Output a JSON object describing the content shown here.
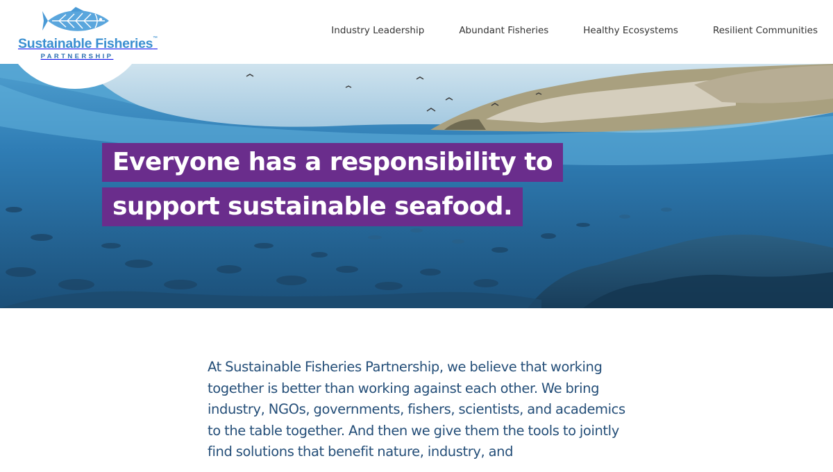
{
  "brand": {
    "name": "Sustainable Fisheries",
    "tm": "™",
    "subtitle": "PARTNERSHIP"
  },
  "nav": {
    "items": [
      {
        "label": "Industry Leadership"
      },
      {
        "label": "Abundant Fisheries"
      },
      {
        "label": "Healthy Ecosystems"
      },
      {
        "label": "Resilient Communities"
      }
    ]
  },
  "hero": {
    "headline_line1": "Everyone has a responsibility to",
    "headline_line2": "support sustainable seafood.",
    "image_icon": "underwater-fish-coastline-image"
  },
  "intro": {
    "text": "At Sustainable Fisheries Partnership, we believe that working together is better than working against each other. We bring industry, NGOs, governments, fishers, scientists, and academics to the table together. And then we give them the tools to jointly find solutions that benefit nature, industry, and"
  },
  "colors": {
    "brand_blue": "#3a8fd0",
    "headline_bg": "#6a2d8c",
    "body_text": "#244e78",
    "nav_text": "#333333"
  }
}
